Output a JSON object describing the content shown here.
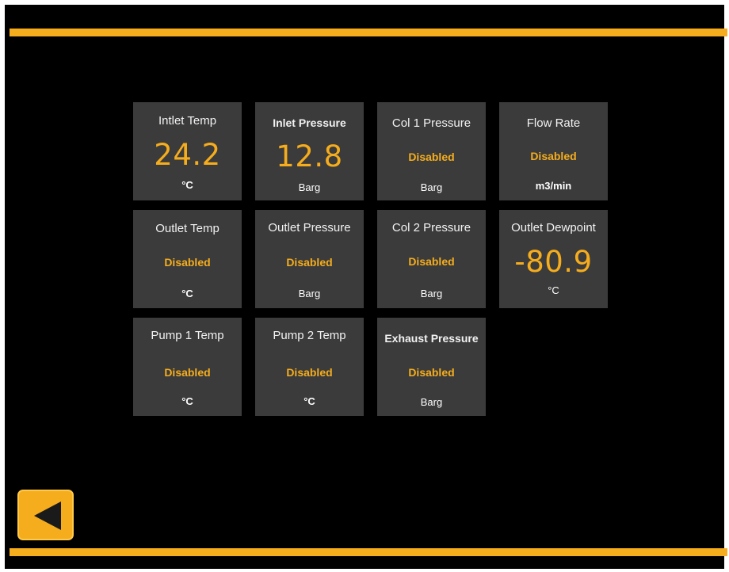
{
  "colors": {
    "accent": "#f5ad1d",
    "tile_background": "#3b3b3b",
    "screen_background": "#000000",
    "text": "#ffffff"
  },
  "tiles": [
    {
      "label": "Intlet Temp",
      "value": "24.2",
      "unit": "°C"
    },
    {
      "label": "Inlet Pressure",
      "value": "12.8",
      "unit": "Barg"
    },
    {
      "label": "Col 1 Pressure",
      "value": "Disabled",
      "unit": "Barg"
    },
    {
      "label": "Flow Rate",
      "value": "Disabled",
      "unit": "m3/min"
    },
    {
      "label": "Outlet Temp",
      "value": "Disabled",
      "unit": "°C"
    },
    {
      "label": "Outlet Pressure",
      "value": "Disabled",
      "unit": "Barg"
    },
    {
      "label": "Col 2 Pressure",
      "value": "Disabled",
      "unit": "Barg"
    },
    {
      "label": "Outlet Dewpoint",
      "value": "-80.9",
      "unit": "°C"
    },
    {
      "label": "Pump 1 Temp",
      "value": "Disabled",
      "unit": "°C"
    },
    {
      "label": "Pump 2 Temp",
      "value": "Disabled",
      "unit": "°C"
    },
    {
      "label": "Exhaust Pressure",
      "value": "Disabled",
      "unit": "Barg"
    }
  ],
  "back_button": {
    "icon": "left-triangle-icon"
  }
}
